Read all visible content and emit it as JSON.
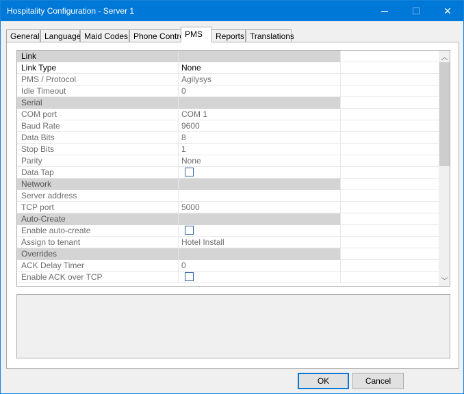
{
  "window": {
    "title": "Hospitality Configuration - Server 1",
    "minimize_icon": "minimize-icon",
    "maximize_icon": "maximize-icon",
    "close_icon": "close-icon",
    "close_glyph": "✕"
  },
  "tabs": [
    {
      "label": "General",
      "active": false
    },
    {
      "label": "Language",
      "active": false
    },
    {
      "label": "Maid Codes",
      "active": false
    },
    {
      "label": "Phone Control",
      "active": false
    },
    {
      "label": "PMS",
      "active": true
    },
    {
      "label": "Reports",
      "active": false
    },
    {
      "label": "Translations",
      "active": false
    }
  ],
  "grid": {
    "rows": [
      {
        "type": "section",
        "label": "Link",
        "value": ""
      },
      {
        "type": "editable",
        "label": "Link Type",
        "value": "None"
      },
      {
        "type": "readonly",
        "label": "PMS / Protocol",
        "value": "Agilysys"
      },
      {
        "type": "readonly",
        "label": "Idle Timeout",
        "value": "0"
      },
      {
        "type": "section",
        "label": "Serial",
        "value": ""
      },
      {
        "type": "readonly",
        "label": "COM port",
        "value": "COM 1"
      },
      {
        "type": "readonly",
        "label": "Baud Rate",
        "value": "9600"
      },
      {
        "type": "readonly",
        "label": "Data Bits",
        "value": "8"
      },
      {
        "type": "readonly",
        "label": "Stop Bits",
        "value": "1"
      },
      {
        "type": "readonly",
        "label": "Parity",
        "value": "None"
      },
      {
        "type": "readonly",
        "label": "Data Tap",
        "checkbox": true,
        "checked": false
      },
      {
        "type": "section",
        "label": "Network",
        "value": ""
      },
      {
        "type": "readonly",
        "label": "Server address",
        "value": ""
      },
      {
        "type": "readonly",
        "label": "TCP port",
        "value": "5000"
      },
      {
        "type": "section",
        "label": "Auto-Create",
        "value": ""
      },
      {
        "type": "readonly",
        "label": "Enable auto-create",
        "checkbox": true,
        "checked": false
      },
      {
        "type": "readonly",
        "label": "Assign to tenant",
        "value": "Hotel Install"
      },
      {
        "type": "section",
        "label": "Overrides",
        "value": ""
      },
      {
        "type": "readonly",
        "label": "ACK Delay Timer",
        "value": "0"
      },
      {
        "type": "readonly",
        "label": "Enable ACK over TCP",
        "checkbox": true,
        "checked": false
      }
    ],
    "scroll_up_glyph": "︿",
    "scroll_down_glyph": "﹀"
  },
  "buttons": {
    "ok": "OK",
    "cancel": "Cancel"
  }
}
